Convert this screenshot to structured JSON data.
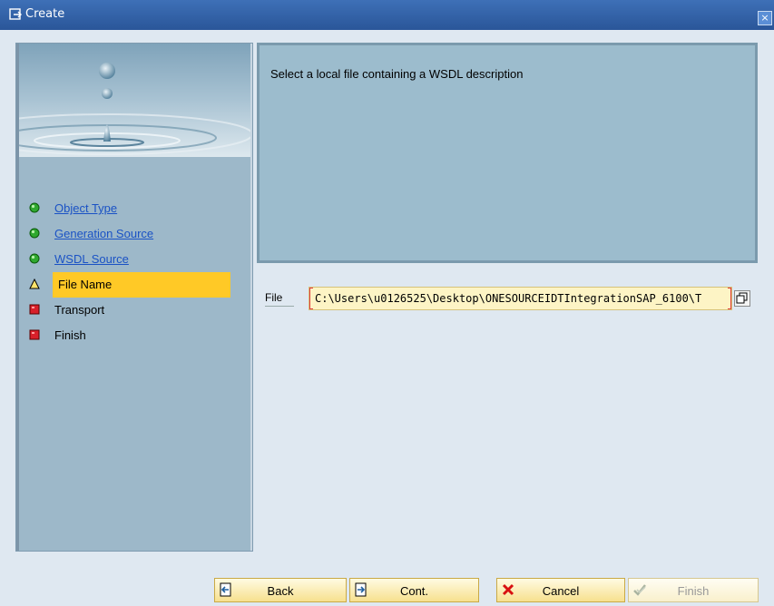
{
  "window": {
    "title": "Create",
    "close_glyph": "×"
  },
  "colors": {
    "titlebar": "#2f5fa6",
    "panel": "#9db8c9",
    "active_step": "#ffc926",
    "input_bg": "#fdf4c5",
    "required_mark": "#e03b3b"
  },
  "steps": [
    {
      "label": "Object Type",
      "status": "done",
      "icon": "green-circle-icon",
      "link": true
    },
    {
      "label": "Generation Source",
      "status": "done",
      "icon": "green-circle-icon",
      "link": true
    },
    {
      "label": "WSDL Source",
      "status": "done",
      "icon": "green-circle-icon",
      "link": true
    },
    {
      "label": "File Name",
      "status": "current",
      "icon": "yellow-triangle-icon",
      "link": false
    },
    {
      "label": "Transport",
      "status": "pending",
      "icon": "red-square-icon",
      "link": false
    },
    {
      "label": "Finish",
      "status": "pending",
      "icon": "red-square-icon",
      "link": false
    }
  ],
  "description": "Select a local file containing a WSDL description",
  "file": {
    "label": "File",
    "value": "C:\\Users\\u0126525\\Desktop\\ONESOURCEIDTIntegrationSAP_6100\\T"
  },
  "buttons": {
    "back": "Back",
    "cont": "Cont.",
    "cancel": "Cancel",
    "finish": "Finish"
  }
}
